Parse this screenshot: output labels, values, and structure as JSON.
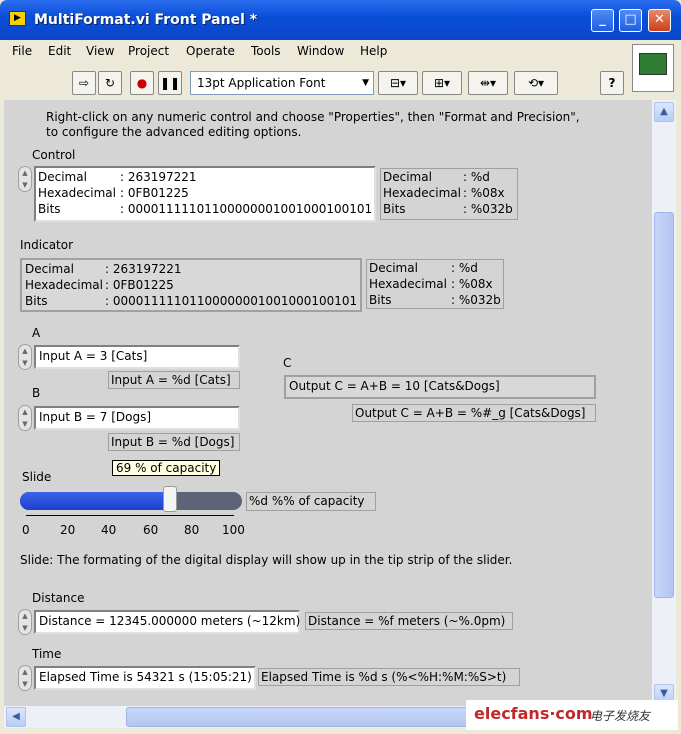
{
  "window": {
    "title": "MultiFormat.vi Front Panel *"
  },
  "menu": [
    "File",
    "Edit",
    "View",
    "Project",
    "Operate",
    "Tools",
    "Window",
    "Help"
  ],
  "toolbar": {
    "font": "13pt Application Font",
    "help": "?"
  },
  "instructions": "Right-click on any numeric control and choose \"Properties\", then \"Format and Precision\",\nto configure the advanced editing options.",
  "control": {
    "label": "Control",
    "rows": [
      {
        "name": "Decimal",
        "value": ": 263197221"
      },
      {
        "name": "Hexadecimal",
        "value": ": 0FB01225"
      },
      {
        "name": "Bits",
        "value": ": 00001111101100000001001000100101"
      }
    ],
    "formats": [
      {
        "name": "Decimal",
        "value": ": %d"
      },
      {
        "name": "Hexadecimal",
        "value": ": %08x"
      },
      {
        "name": "Bits",
        "value": ": %032b"
      }
    ]
  },
  "indicator": {
    "label": "Indicator",
    "rows": [
      {
        "name": "Decimal",
        "value": ": 263197221"
      },
      {
        "name": "Hexadecimal",
        "value": ": 0FB01225"
      },
      {
        "name": "Bits",
        "value": ": 00001111101100000001001000100101"
      }
    ],
    "formats": [
      {
        "name": "Decimal",
        "value": ": %d"
      },
      {
        "name": "Hexadecimal",
        "value": ": %08x"
      },
      {
        "name": "Bits",
        "value": ": %032b"
      }
    ]
  },
  "a": {
    "label": "A",
    "value": "Input A = 3 [Cats]",
    "format": "Input A = %d [Cats]"
  },
  "b": {
    "label": "B",
    "value": "Input B = 7 [Dogs]",
    "format": "Input B = %d [Dogs]"
  },
  "c": {
    "label": "C",
    "value": "Output C = A+B  = 10 [Cats&Dogs]",
    "format": "Output C = A+B  = %#_g [Cats&Dogs]"
  },
  "slide": {
    "label": "Slide",
    "tip": "69 % of capacity",
    "format": "%d %% of capacity",
    "value": 69,
    "min": 0,
    "max": 100,
    "ticks": [
      "0",
      "20",
      "40",
      "60",
      "80",
      "100"
    ],
    "note": "Slide: The formating of the digital display will show up in the tip strip of the slider."
  },
  "distance": {
    "label": "Distance",
    "value": "Distance = 12345.000000 meters (~12km)",
    "format": "Distance = %f meters (~%.0pm)"
  },
  "time": {
    "label": "Time",
    "value": "Elapsed Time is 54321 s (15:05:21)",
    "format": "Elapsed Time is %d s (%<%H:%M:%S>t)"
  },
  "watermark": {
    "site": "elecfans·com",
    "cn": "电子发烧友"
  },
  "colors": {
    "title_blue": "#0a4fd8",
    "slider_fill": "#1c3fd0",
    "panel_gray": "#d4d4d4"
  }
}
